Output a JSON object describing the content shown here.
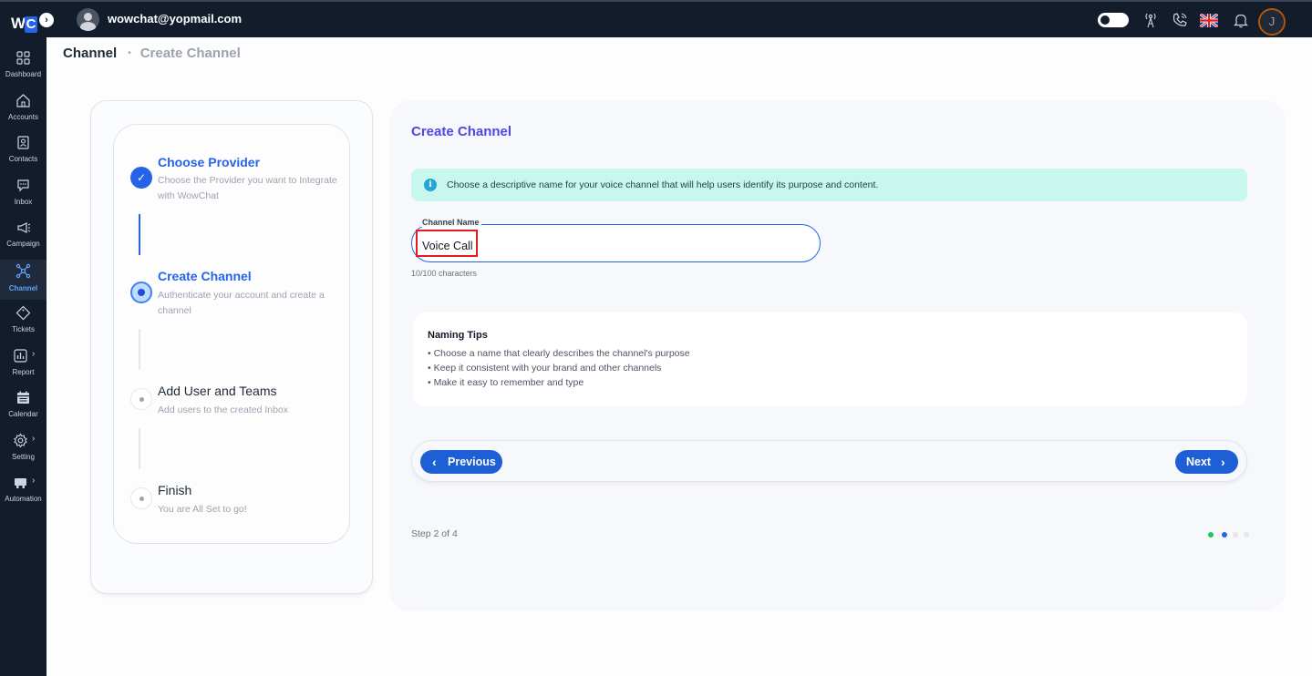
{
  "topbar": {
    "user_email": "wowchat@yopmail.com",
    "avatar_initial": "J",
    "logo_w": "W",
    "logo_c": "C"
  },
  "sidebar": {
    "items": [
      {
        "label": "Dashboard"
      },
      {
        "label": "Accounts"
      },
      {
        "label": "Contacts"
      },
      {
        "label": "Inbox"
      },
      {
        "label": "Campaign"
      },
      {
        "label": "Channel"
      },
      {
        "label": "Tickets"
      },
      {
        "label": "Report"
      },
      {
        "label": "Calendar"
      },
      {
        "label": "Setting"
      },
      {
        "label": "Automation"
      }
    ]
  },
  "breadcrumb": {
    "current": "Channel",
    "child": "Create Channel"
  },
  "stepper": {
    "steps": [
      {
        "title": "Choose Provider",
        "desc": "Choose the Provider you want to Integrate with WowChat",
        "status": "done"
      },
      {
        "title": "Create Channel",
        "desc": "Authenticate your account and create a channel",
        "status": "current"
      },
      {
        "title": "Add User and Teams",
        "desc": "Add users to the created Inbox",
        "status": "pending"
      },
      {
        "title": "Finish",
        "desc": "You are All Set to go!",
        "status": "pending"
      }
    ]
  },
  "form": {
    "title": "Create Channel",
    "info": "Choose a descriptive name for your voice channel that will help users identify its purpose and content.",
    "field_label": "Channel Name",
    "field_value": "Voice Call",
    "char_count": "10/100 characters",
    "tips_title": "Naming Tips",
    "tips": [
      "• Choose a name that clearly describes the channel's purpose",
      "• Keep it consistent with your brand and other channels",
      "• Make it easy to remember and type"
    ],
    "prev_label": "Previous",
    "next_label": "Next",
    "step_text": "Step 2 of 4"
  },
  "colors": {
    "accent": "#2563eb",
    "sidebar_bg": "#121c2b",
    "title_accent": "#4f46e5",
    "info_bg": "#c8f7ee",
    "progress_done": "#22c55e",
    "progress_current": "#2563eb",
    "progress_pending": "#d1d5db"
  }
}
